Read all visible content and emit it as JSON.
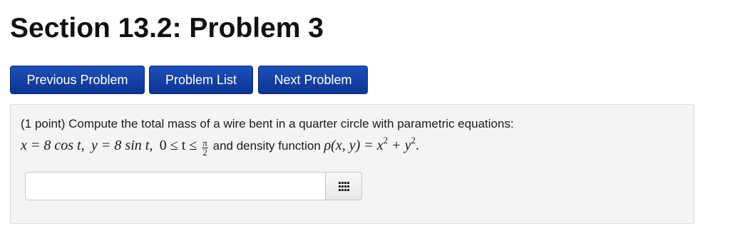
{
  "header": {
    "title": "Section 13.2: Problem 3"
  },
  "nav": {
    "prev_label": "Previous Problem",
    "list_label": "Problem List",
    "next_label": "Next Problem"
  },
  "problem": {
    "points": "(1 point)",
    "statement": "Compute the total mass of a wire bent in a quarter circle with parametric equations:",
    "equation_x": "x = 8 cos t,",
    "equation_y": "y = 8 sin t,",
    "range_prefix": "0 ≤ t ≤",
    "range_num": "π",
    "range_den": "2",
    "density_label": "and density function",
    "density_lhs": "ρ(x, y) = x",
    "density_exp1": "2",
    "density_plus": "+ y",
    "density_exp2": "2",
    "density_end": "."
  },
  "answer": {
    "value": "",
    "placeholder": ""
  },
  "icons": {
    "palette": "equation-palette-grid-icon"
  },
  "colors": {
    "button_blue": "#0c3493",
    "panel_bg": "#f4f4f4"
  }
}
